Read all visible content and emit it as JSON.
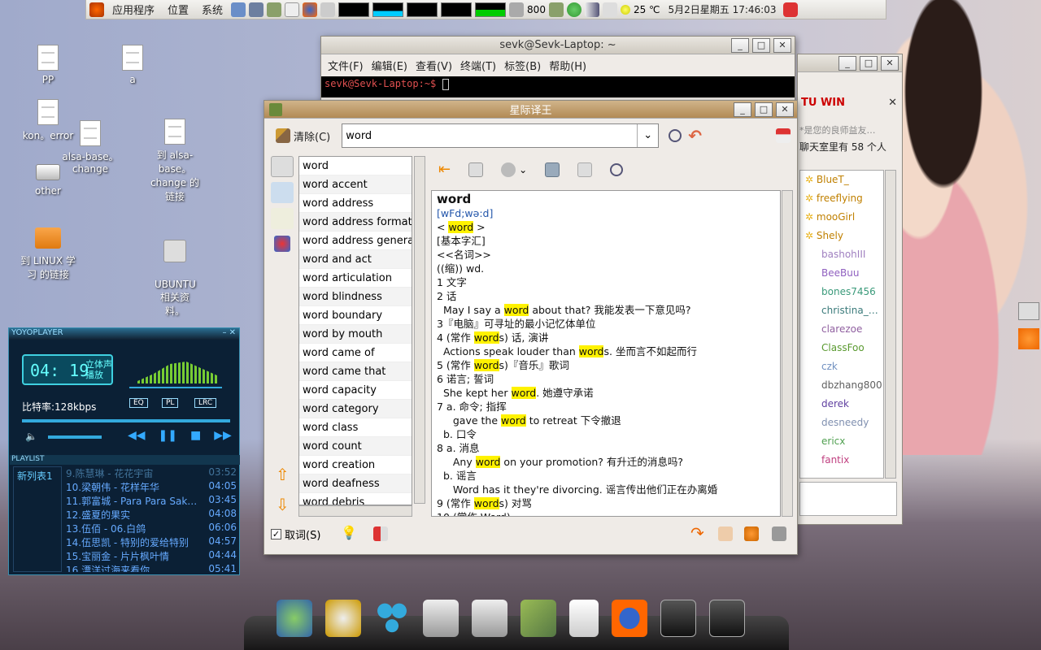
{
  "panel": {
    "apps": "应用程序",
    "places": "位置",
    "system": "系统",
    "cpu_freq": "800",
    "temp": "25 ℃",
    "datetime": "5月2日星期五 17:46:03"
  },
  "desktop": {
    "icons": [
      {
        "label": "PP"
      },
      {
        "label": "a"
      },
      {
        "label": "kon。error"
      },
      {
        "label": "alsa-base。change"
      },
      {
        "label": "到 alsa-base。change 的链接"
      },
      {
        "label": "other"
      },
      {
        "label": "到 LINUX 学习 的链接"
      },
      {
        "label": "UBUNTU相关资料。"
      }
    ]
  },
  "terminal": {
    "title": "sevk@Sevk-Laptop: ~",
    "menu": [
      "文件(F)",
      "编辑(E)",
      "查看(V)",
      "终端(T)",
      "标签(B)",
      "帮助(H)"
    ],
    "prompt": "sevk@Sevk-Laptop:~$ "
  },
  "dict": {
    "title": "星际译王",
    "clear": "清除(C)",
    "query": "word",
    "words": [
      "word",
      "word accent",
      "word address",
      "word address format",
      "word address generate",
      "word and act",
      "word articulation",
      "word blindness",
      "word boundary",
      "word by mouth",
      "word came of",
      "word came that",
      "word capacity",
      "word category",
      "word class",
      "word count",
      "word creation",
      "word deafness",
      "word debris"
    ],
    "headword": "word",
    "phonetic": "[wFd;wə:d]",
    "bottom_check": "取词(S)"
  },
  "chat": {
    "title": "TU WIN",
    "line1": "*是您的良师益友…",
    "line2": "聊天室里有 58 个人",
    "users": [
      {
        "name": "BlueT_",
        "color": "#c08000"
      },
      {
        "name": "freeflying",
        "color": "#c08000"
      },
      {
        "name": "mooGirl",
        "color": "#c08000"
      },
      {
        "name": "Shely",
        "color": "#c08000"
      },
      {
        "name": "bashohIII",
        "color": "#a080c0"
      },
      {
        "name": "BeeBuu",
        "color": "#9060c0"
      },
      {
        "name": "bones7456",
        "color": "#3a9a7a"
      },
      {
        "name": "christina_…",
        "color": "#3a7a7a"
      },
      {
        "name": "clarezoe",
        "color": "#9060a0"
      },
      {
        "name": "ClassFoo",
        "color": "#5a9a30"
      },
      {
        "name": "czk",
        "color": "#7090c0"
      },
      {
        "name": "dbzhang800",
        "color": "#606060"
      },
      {
        "name": "derek",
        "color": "#6040a0"
      },
      {
        "name": "desneedy",
        "color": "#8090b0"
      },
      {
        "name": "ericx",
        "color": "#50a050"
      },
      {
        "name": "fantix",
        "color": "#c04080"
      }
    ]
  },
  "player": {
    "name": "YOYOPLAYER",
    "time": "04: 19",
    "mode": "立体声 播放",
    "bitrate": "比特率:128kbps",
    "eq": "EQ",
    "pl": "PL",
    "lrc": "LRC",
    "playlist_label": "PLAYLIST",
    "list_name": "新列表1",
    "tracks": [
      {
        "t": "9.陈慧琳 - 花花宇宙",
        "d": "03:52"
      },
      {
        "t": "10.梁朝伟 - 花样年华",
        "d": "04:05"
      },
      {
        "t": "11.郭富城 - Para Para Sak…",
        "d": "03:45"
      },
      {
        "t": "12.盛夏的果实",
        "d": "04:08"
      },
      {
        "t": "13.伍佰 - 06.白鸽",
        "d": "06:06"
      },
      {
        "t": "14.伍思凯 - 特别的爱给特别",
        "d": "04:57"
      },
      {
        "t": "15.宝丽金 - 片片枫叶情",
        "d": "04:44"
      },
      {
        "t": "16.漂洋过海来看你",
        "d": "05:41"
      }
    ]
  }
}
